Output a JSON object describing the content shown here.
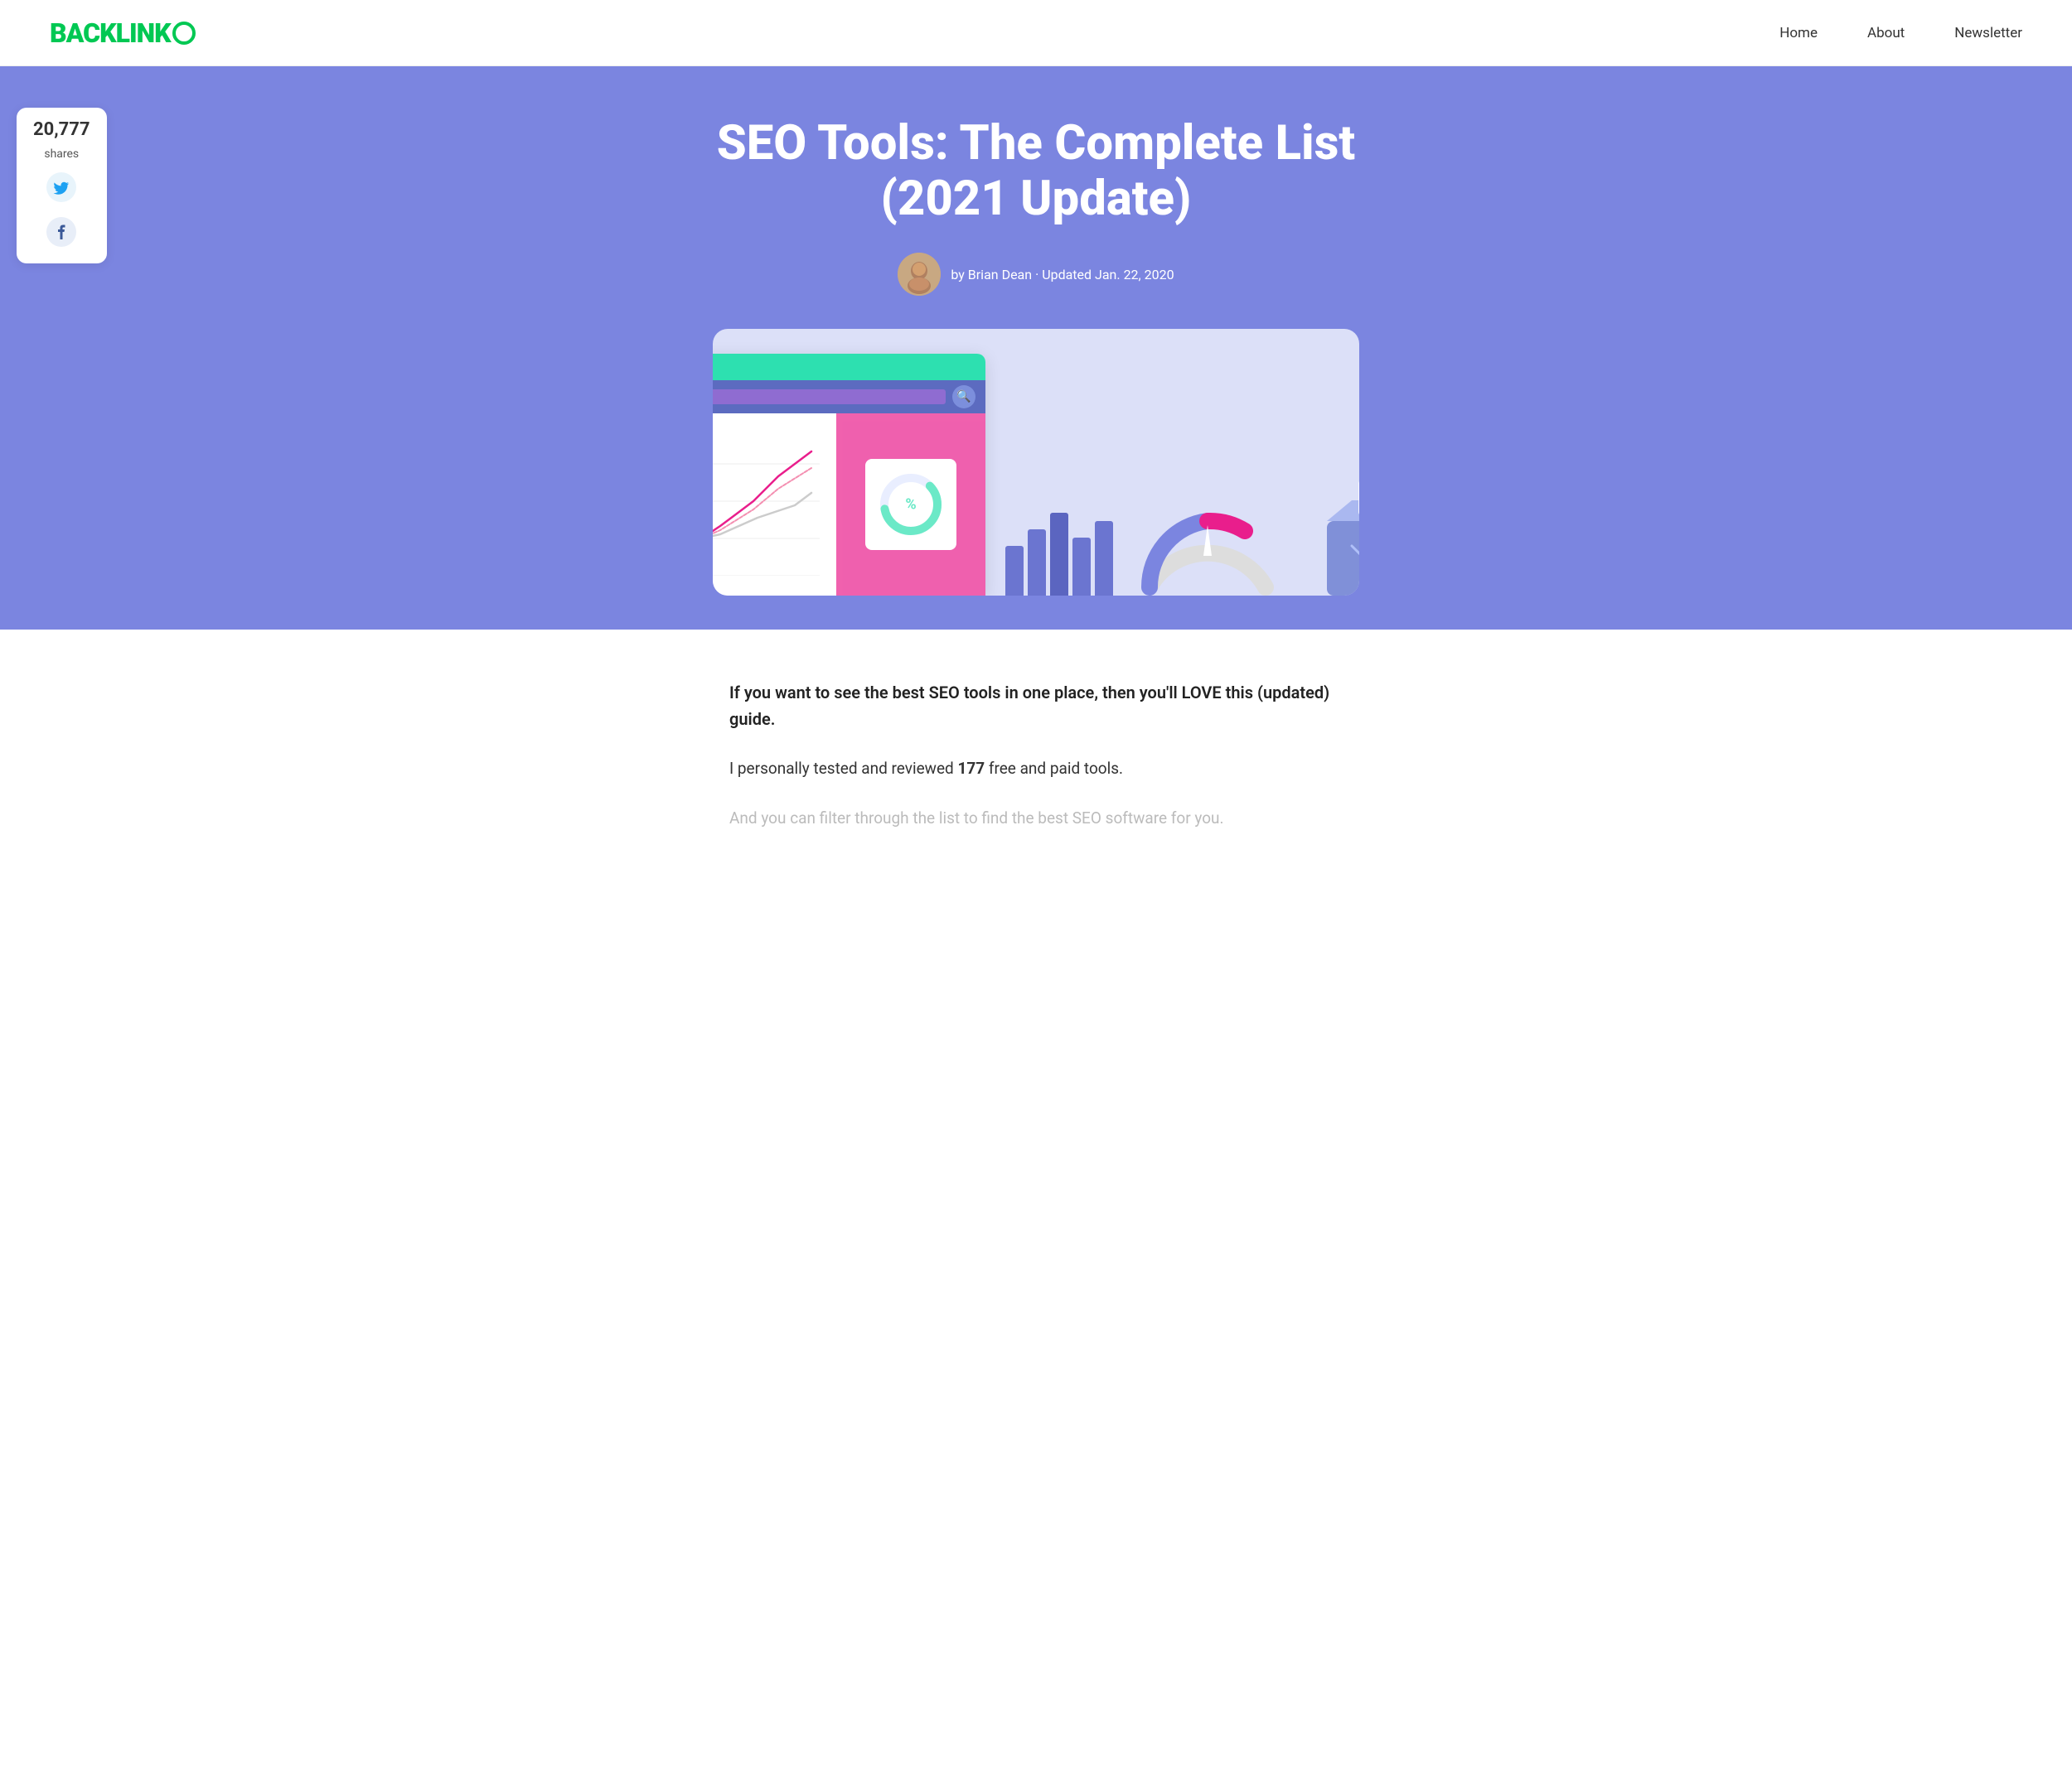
{
  "nav": {
    "logo": "BACKLINK",
    "logo_o": "O",
    "links": [
      "Home",
      "About",
      "Newsletter"
    ]
  },
  "hero": {
    "title": "SEO Tools: The Complete List (2021 Update)",
    "author": "by Brian Dean · Updated Jan. 22, 2020"
  },
  "share": {
    "count": "20,777",
    "label": "shares"
  },
  "content": {
    "intro_bold": "If you want to see the best SEO tools in one place, then you'll LOVE this (updated) guide.",
    "intro_normal_prefix": "I personally tested and reviewed ",
    "intro_normal_number": "177",
    "intro_normal_suffix": " free and paid tools.",
    "intro_faded": "And you can filter through the list to find the best SEO software for you."
  },
  "illustration": {
    "dots": [
      "",
      "",
      ""
    ],
    "bar_heights": [
      60,
      80,
      100,
      70,
      90
    ],
    "bar_colors": [
      "#7b85e0",
      "#7b85e0",
      "#7b85e0",
      "#7b85e0",
      "#7b85e0"
    ]
  }
}
